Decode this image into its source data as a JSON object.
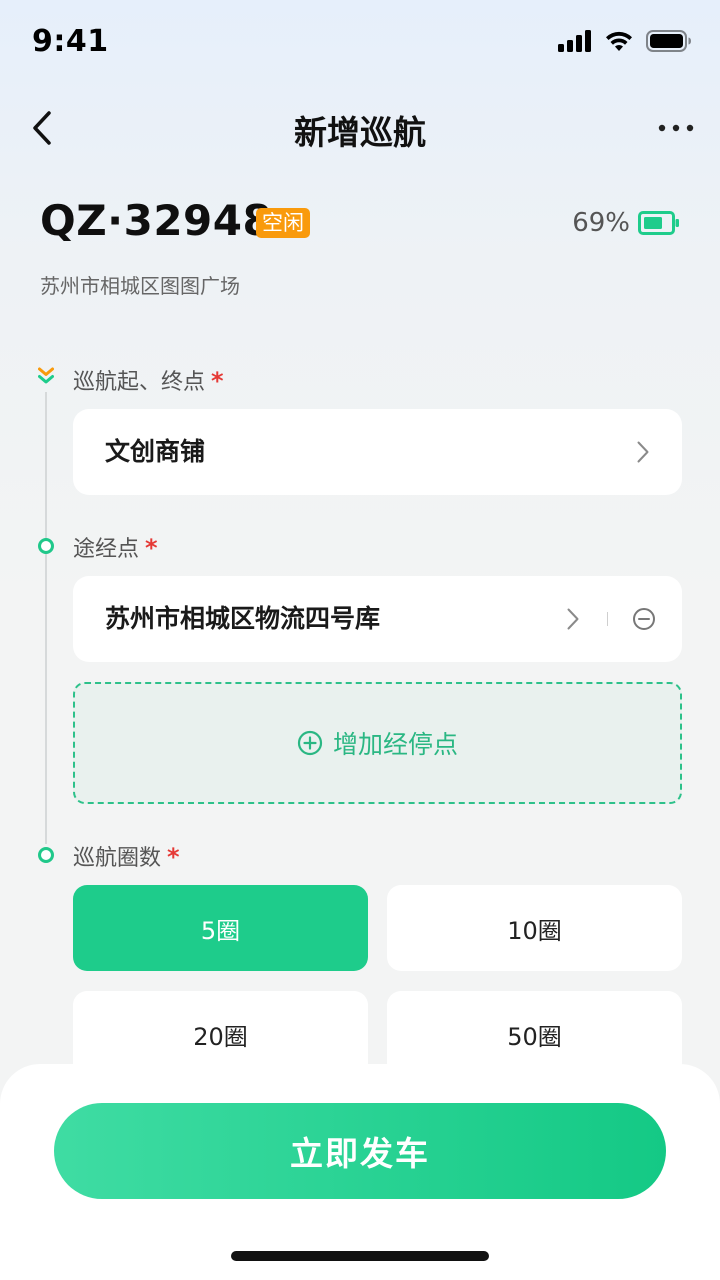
{
  "status_bar": {
    "time": "9:41"
  },
  "nav": {
    "title": "新增巡航"
  },
  "vehicle": {
    "plate": "QZ·32948",
    "state": "空闲",
    "battery_percent": "69%",
    "location": "苏州市相城区图图广场"
  },
  "route": {
    "start_end_label": "巡航起、终点",
    "start_end_value": "文创商铺",
    "waypoint_label": "途经点",
    "waypoints": [
      "苏州市相城区物流四号库"
    ],
    "add_stop_label": "增加经停点",
    "required_mark": "*"
  },
  "laps": {
    "label": "巡航圈数",
    "options": [
      "5圈",
      "10圈",
      "20圈",
      "50圈"
    ],
    "selected": "5圈"
  },
  "cta": {
    "label": "立即发车"
  },
  "colors": {
    "accent": "#1ecc8b",
    "badge": "#f99a0c",
    "required": "#e53935"
  },
  "icons": {
    "back": "chevron-left-icon",
    "more": "more-dots-icon",
    "battery": "battery-icon",
    "chevron": "chevron-right-icon",
    "remove": "minus-circle-icon",
    "add": "plus-circle-icon",
    "start": "double-chevron-down-icon"
  }
}
